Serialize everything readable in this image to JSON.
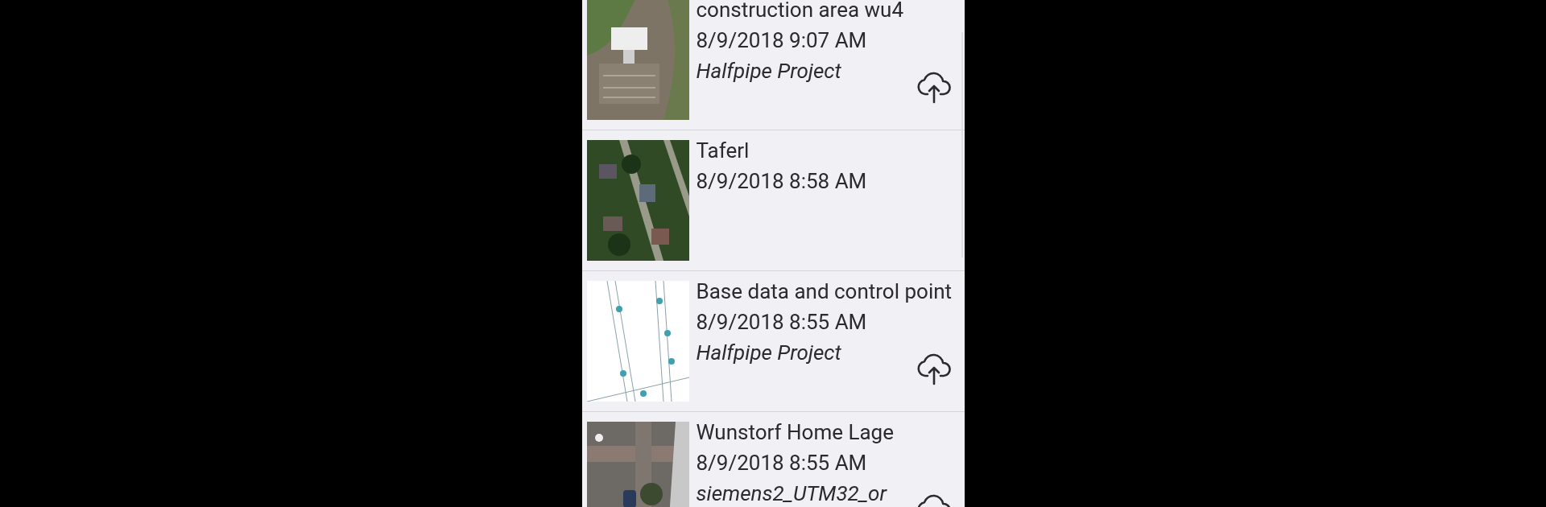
{
  "projects": [
    {
      "title": "construction area wu4",
      "date": "8/9/2018 9:07 AM",
      "project": "Halfpipe Project",
      "upload_available": true
    },
    {
      "title": "Taferl",
      "date": "8/9/2018 8:58 AM",
      "upload_available": false
    },
    {
      "title": "Base data and control point",
      "date": "8/9/2018 8:55 AM",
      "project": "Halfpipe Project",
      "upload_available": true
    },
    {
      "title": "Wunstorf Home Lage",
      "date": "8/9/2018 8:55 AM",
      "project": "siemens2_UTM32_or",
      "upload_available": true
    }
  ]
}
